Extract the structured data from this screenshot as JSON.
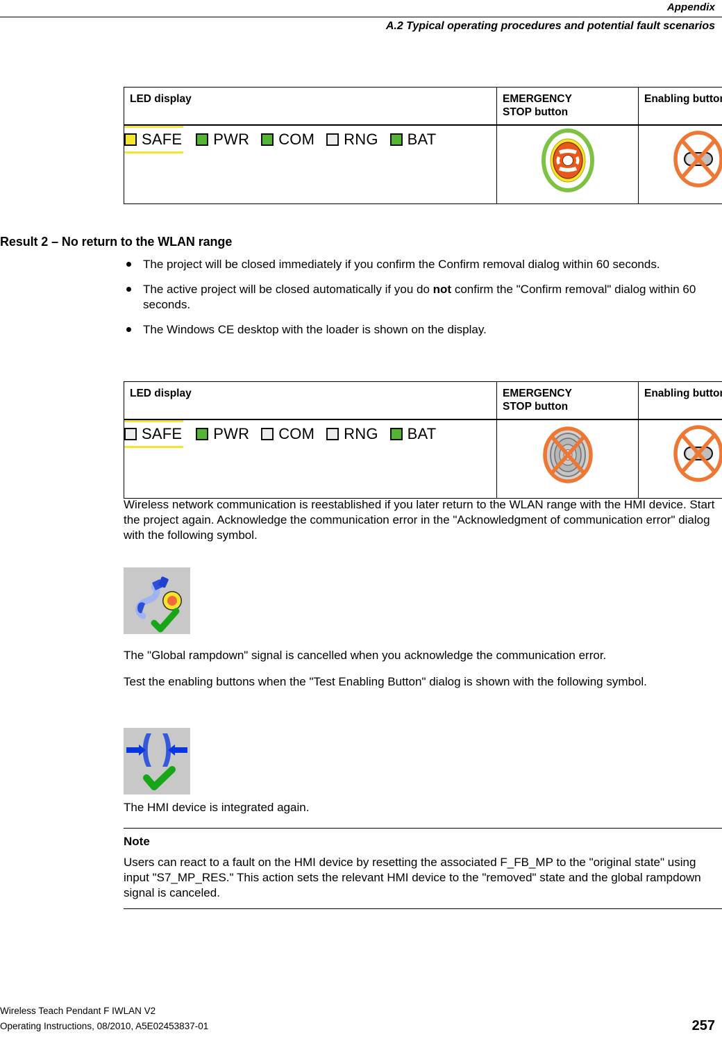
{
  "header": {
    "title": "Appendix",
    "section": "A.2 Typical operating procedures and potential fault scenarios"
  },
  "tables": [
    {
      "name": "led-state-table-1",
      "columns": [
        "LED display",
        "EMERGENCY\nSTOP button",
        "Enabling button"
      ],
      "leds": [
        {
          "label": "SAFE",
          "state": "yellow",
          "color": "#F5E62C",
          "highlighted": true
        },
        {
          "label": "PWR",
          "state": "green",
          "color": "#55B336",
          "highlighted": false
        },
        {
          "label": "COM",
          "state": "green",
          "color": "#55B336",
          "highlighted": false
        },
        {
          "label": "RNG",
          "state": "off",
          "color": "#EDEDED",
          "highlighted": false
        },
        {
          "label": "BAT",
          "state": "green",
          "color": "#55B336",
          "highlighted": false
        }
      ],
      "emergency_stop": {
        "icon": "emergency-stop-active-icon",
        "active": true
      },
      "enabling_button": {
        "icon": "enabling-button-disabled-icon",
        "active": false
      }
    },
    {
      "name": "led-state-table-2",
      "columns": [
        "LED display",
        "EMERGENCY\nSTOP button",
        "Enabling button"
      ],
      "leds": [
        {
          "label": "SAFE",
          "state": "off",
          "color": "#EDEDED",
          "highlighted": true
        },
        {
          "label": "PWR",
          "state": "green",
          "color": "#55B336",
          "highlighted": false
        },
        {
          "label": "COM",
          "state": "off",
          "color": "#EDEDED",
          "highlighted": false
        },
        {
          "label": "RNG",
          "state": "off",
          "color": "#EDEDED",
          "highlighted": false
        },
        {
          "label": "BAT",
          "state": "green",
          "color": "#55B336",
          "highlighted": false
        }
      ],
      "emergency_stop": {
        "icon": "emergency-stop-disabled-icon",
        "active": false
      },
      "enabling_button": {
        "icon": "enabling-button-disabled-icon",
        "active": false
      }
    }
  ],
  "result_heading": "Result 2 – No return to the WLAN range",
  "bullets": [
    {
      "pre": "The project will be closed immediately if you confirm the Confirm removal dialog within 60 seconds.",
      "bold": "",
      "post": ""
    },
    {
      "pre": "The active project will be closed automatically if you do ",
      "bold": "not",
      "post": " confirm the \"Confirm removal\" dialog within 60 seconds."
    },
    {
      "pre": "The Windows CE desktop with the loader is shown on the display.",
      "bold": "",
      "post": ""
    }
  ],
  "paragraphs": {
    "after_table2": "Wireless network communication is reestablished if you later return to the WLAN range with the HMI device. Start the project again. Acknowledge the communication error in the \"Acknowledgment of communication error\" dialog with the following symbol.",
    "after_symbol1": "The \"Global rampdown\" signal is cancelled when you acknowledge the communication error.",
    "before_symbol2": "Test the enabling buttons when the \"Test Enabling Button\" dialog is shown with the following symbol.",
    "after_symbol2": "The HMI device is integrated again."
  },
  "symbols": [
    {
      "name": "acknowledge-communication-error-symbol",
      "background": "#C8C8C8"
    },
    {
      "name": "test-enabling-button-symbol",
      "background": "#C8C8C8"
    }
  ],
  "note": {
    "title": "Note",
    "body": "Users can react to a fault on the HMI device by resetting the associated F_FB_MP to the \"original state\" using input \"S7_MP_RES.\" This action sets the relevant HMI device to the \"removed\" state and the global rampdown signal is canceled."
  },
  "footer": {
    "line1": "Wireless Teach Pendant F IWLAN V2",
    "line2": "Operating Instructions, 08/2010, A5E02453837-01",
    "page": "257"
  },
  "colors": {
    "led_green": "#55B336",
    "led_yellow": "#F5E62C",
    "led_off": "#EDEDED",
    "orange": "#EE7733",
    "estop_green_ring": "#7DC242",
    "estop_red": "#E8571B",
    "gray_tile": "#C8C8C8"
  }
}
